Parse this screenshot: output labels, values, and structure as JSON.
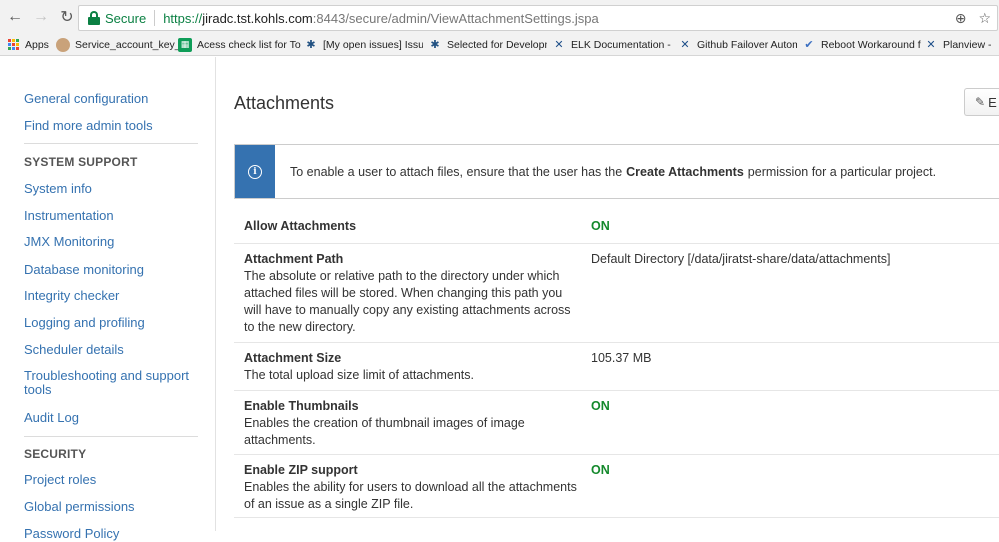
{
  "browser": {
    "back_icon": "←",
    "forward_icon": "→",
    "reload_icon": "↻",
    "secure_label": "Secure",
    "url_scheme": "https://",
    "url_host": "jiradc.tst.kohls.com",
    "url_rest": ":8443/secure/admin/ViewAttachmentSettings.jspa",
    "zoom_icon": "⊕",
    "star_icon": "☆"
  },
  "bookmarks": [
    {
      "label": "Apps",
      "icon": "apps-grid"
    },
    {
      "label": "Service_account_key_",
      "icon": "user-icon"
    },
    {
      "label": "Acess check list for To",
      "icon": "sheets-icon"
    },
    {
      "label": "[My open issues] Issu",
      "icon": "jira-icon"
    },
    {
      "label": "Selected for Developm",
      "icon": "jira-icon"
    },
    {
      "label": "ELK Documentation - ",
      "icon": "confluence-icon"
    },
    {
      "label": "Github Failover Autom",
      "icon": "confluence-icon"
    },
    {
      "label": "Reboot Workaround fo",
      "icon": "check-icon"
    },
    {
      "label": "Planview - ",
      "icon": "confluence-icon"
    }
  ],
  "sidebar": {
    "top_links": [
      "General configuration",
      "Find more admin tools"
    ],
    "system_support_heading": "SYSTEM SUPPORT",
    "system_support_links": [
      "System info",
      "Instrumentation",
      "JMX Monitoring",
      "Database monitoring",
      "Integrity checker",
      "Logging and profiling",
      "Scheduler details",
      "Troubleshooting and support tools",
      "Audit Log"
    ],
    "security_heading": "SECURITY",
    "security_links": [
      "Project roles",
      "Global permissions",
      "Password Policy"
    ]
  },
  "main": {
    "title": "Attachments",
    "edit_label": "E",
    "info": {
      "before": "To enable a user to attach files, ensure that the user has the",
      "bold": "Create Attachments",
      "after": "permission for a particular project."
    },
    "settings": [
      {
        "label": "Allow Attachments",
        "desc": "",
        "value": "ON",
        "is_on": true
      },
      {
        "label": "Attachment Path",
        "desc": "The absolute or relative path to the directory under which attached files will be stored. When changing this path you will have to manually copy any existing attachments across to the new directory.",
        "value": "Default Directory [/data/jiratst-share/data/attachments]",
        "is_on": false
      },
      {
        "label": "Attachment Size",
        "desc": "The total upload size limit of attachments.",
        "value": "105.37 MB",
        "is_on": false
      },
      {
        "label": "Enable Thumbnails",
        "desc": "Enables the creation of thumbnail images of image attachments.",
        "value": "ON",
        "is_on": true
      },
      {
        "label": "Enable ZIP support",
        "desc": "Enables the ability for users to download all the attachments of an issue as a single ZIP file.",
        "value": "ON",
        "is_on": true
      }
    ]
  },
  "colors": {
    "link": "#3572b0",
    "on_status": "#14892c",
    "info_bar": "#3572b0",
    "secure": "#0b8043"
  }
}
